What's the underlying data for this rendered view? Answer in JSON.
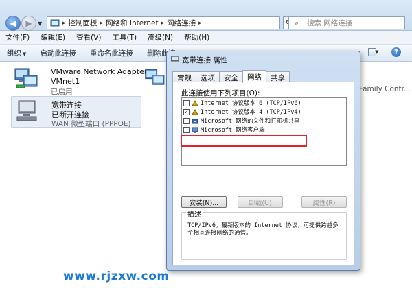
{
  "address_bar": {
    "breadcrumbs": [
      "控制面板",
      "网络和 Internet",
      "网络连接"
    ],
    "search_placeholder": "搜索 网络连接"
  },
  "menu": {
    "items": [
      "文件(F)",
      "编辑(E)",
      "查看(V)",
      "工具(T)",
      "高级(N)",
      "帮助(H)"
    ]
  },
  "commands": {
    "organize": "组织",
    "items": [
      "启动此连接",
      "重命名此连接",
      "删除此连"
    ]
  },
  "adapters": [
    {
      "name": "VMware Network Adapter",
      "name_line2": "VMnet1",
      "status": "已启用"
    },
    {
      "name": "宽带连接",
      "status": "已断开连接",
      "device": "WAN 微型端口 (PPPOE)"
    }
  ],
  "partial_text": "Family Contr...",
  "dialog": {
    "title": "宽带连接 属性",
    "tabs": [
      "常规",
      "选项",
      "安全",
      "网络",
      "共享"
    ],
    "active_tab": "网络",
    "list_label": "此连接使用下列项目(O):",
    "items": [
      {
        "label": "Internet 协议版本 6 (TCP/IPv6)",
        "checked": false
      },
      {
        "label": "Internet 协议版本 4 (TCP/IPv4)",
        "checked": true
      },
      {
        "label": "Microsoft 网络的文件和打印机共享",
        "checked": false
      },
      {
        "label": "Microsoft 网络客户端",
        "checked": false
      }
    ],
    "buttons": {
      "install": "安装(N)...",
      "uninstall": "卸载(U)",
      "properties": "属性(R)"
    },
    "description_title": "描述",
    "description": "TCP/IPv6。最新版本的 Internet 协议，可提供跨越多个相互连接网络的通信。"
  },
  "watermark": "www.rjzxw.com",
  "colors": {
    "highlight_box": "#e0242a",
    "watermark": "#1c7ad3"
  }
}
